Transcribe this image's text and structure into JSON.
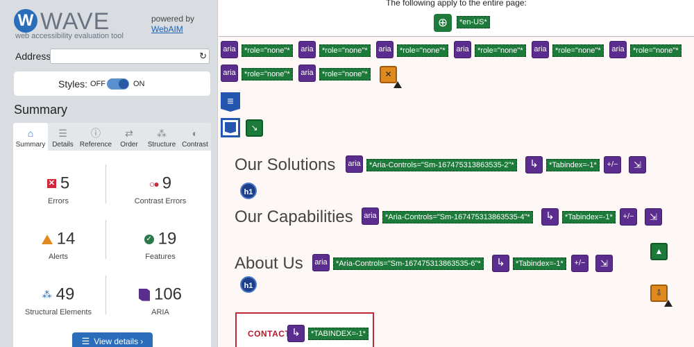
{
  "app": {
    "logo_letter": "W",
    "logo_text": "WAVE",
    "logo_subtitle": "web accessibility evaluation tool",
    "powered_by": "powered by",
    "powered_link": "WebAIM"
  },
  "address": {
    "label": "Address:",
    "value": "",
    "placeholder": ""
  },
  "styles": {
    "label": "Styles:",
    "off": "OFF",
    "on": "ON",
    "state": "on"
  },
  "summary": {
    "heading": "Summary",
    "tabs": [
      {
        "label": "Summary",
        "icon": "home-icon",
        "glyph": "⌂",
        "active": true
      },
      {
        "label": "Details",
        "icon": "list-icon",
        "glyph": "☰",
        "active": false
      },
      {
        "label": "Reference",
        "icon": "info-icon",
        "glyph": "ⓘ",
        "active": false
      },
      {
        "label": "Order",
        "icon": "order-icon",
        "glyph": "⇄",
        "active": false
      },
      {
        "label": "Structure",
        "icon": "structure-icon",
        "glyph": "⁂",
        "active": false
      },
      {
        "label": "Contrast",
        "icon": "contrast-icon",
        "glyph": "◐",
        "active": false
      }
    ],
    "stats": [
      {
        "label": "Errors",
        "value": "5",
        "icon": "error-icon"
      },
      {
        "label": "Contrast Errors",
        "value": "9",
        "icon": "contrast-error-icon"
      },
      {
        "label": "Alerts",
        "value": "14",
        "icon": "alert-icon"
      },
      {
        "label": "Features",
        "value": "19",
        "icon": "feature-icon"
      },
      {
        "label": "Structural Elements",
        "value": "49",
        "icon": "structure-icon"
      },
      {
        "label": "ARIA",
        "value": "106",
        "icon": "aria-icon"
      }
    ],
    "view_details": "View details ›"
  },
  "main": {
    "top_text": "The following apply to the entire page:",
    "lang_tag": "*en-US*",
    "role_tag": "*role=\"none\"*",
    "aria_label": "aria",
    "h1_label": "h1",
    "plus_minus": "+/−",
    "headings": {
      "solutions": "Our Solutions",
      "capabilities": "Our Capabilities",
      "about": "About Us",
      "contact": "CONTACT"
    },
    "tags": {
      "controls_2": "*Aria-Controls=\"Sm-167475313863535-2\"*",
      "controls_4": "*Aria-Controls=\"Sm-167475313863535-4\"*",
      "controls_6": "*Aria-Controls=\"Sm-167475313863535-6\"*",
      "tabindex": "*Tabindex=-1*",
      "tabindex_upper": "*TABINDEX=-1*"
    }
  },
  "colors": {
    "aria_purple": "#5b2d8e",
    "tag_green": "#1e7a3a",
    "error_red": "#d0273b",
    "alert_orange": "#e08a1e",
    "brand_blue": "#2a6ebb"
  }
}
